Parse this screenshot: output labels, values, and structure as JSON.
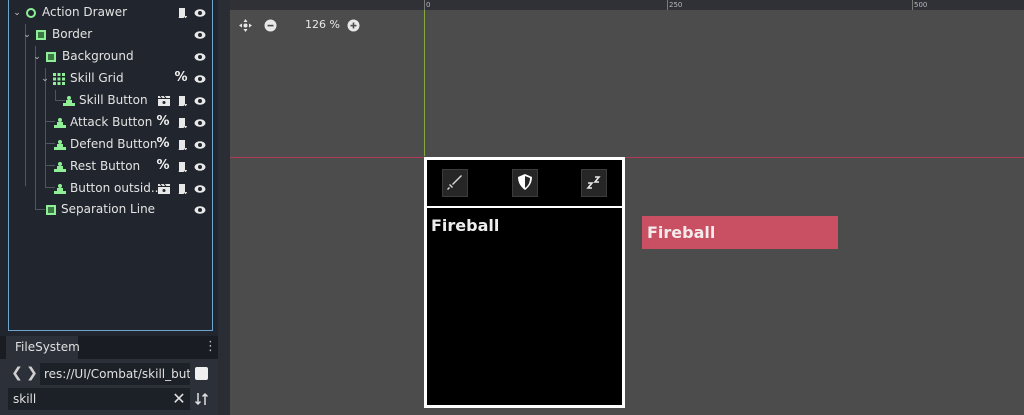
{
  "scene_tree": {
    "nodes": [
      {
        "label": "Action Drawer",
        "icon": "control-node-icon",
        "badges": [
          "script-icon"
        ]
      },
      {
        "label": "Border",
        "icon": "panel-icon",
        "badges": []
      },
      {
        "label": "Background",
        "icon": "panel-icon",
        "badges": []
      },
      {
        "label": "Skill Grid",
        "icon": "grid-container-icon",
        "badges": [
          "percent-icon"
        ]
      },
      {
        "label": "Skill Button",
        "icon": "button-icon",
        "badges": [
          "clapperboard-icon",
          "script-icon"
        ]
      },
      {
        "label": "Attack Button",
        "icon": "button-icon",
        "badges": [
          "percent-icon",
          "script-icon"
        ]
      },
      {
        "label": "Defend Button",
        "icon": "button-icon",
        "badges": [
          "percent-icon",
          "script-icon"
        ]
      },
      {
        "label": "Rest Button",
        "icon": "button-icon",
        "badges": [
          "percent-icon",
          "script-icon"
        ]
      },
      {
        "label": "Button outsid...",
        "icon": "button-icon",
        "badges": [
          "clapperboard-icon",
          "script-icon"
        ]
      },
      {
        "label": "Separation Line",
        "icon": "panel-icon",
        "badges": []
      }
    ],
    "percent_symbol": "%"
  },
  "filesystem": {
    "tab_label": "FileSystem",
    "menu_glyph": "⋮",
    "path": "res://UI/Combat/skill_butto",
    "filter": "skill",
    "back_glyph": "❮",
    "forward_glyph": "❯",
    "clear_glyph": "✕"
  },
  "viewport": {
    "zoom_level": "126 %",
    "ruler_top_labels": [
      "0",
      "250",
      "500"
    ],
    "ruler_left_labels": [
      "0",
      "250"
    ]
  },
  "canvas": {
    "description_title": "Fireball",
    "outside_button_label": "Fireball",
    "skill_icons": [
      "sword-icon",
      "shield-icon",
      "sleep-icon"
    ]
  },
  "colors": {
    "selection_outline": "#6ea5cf",
    "node_green": "#8eef97",
    "button_outside": "#c94f63",
    "guide_vertical": "#86a83e",
    "guide_horizontal": "#b03a55"
  }
}
